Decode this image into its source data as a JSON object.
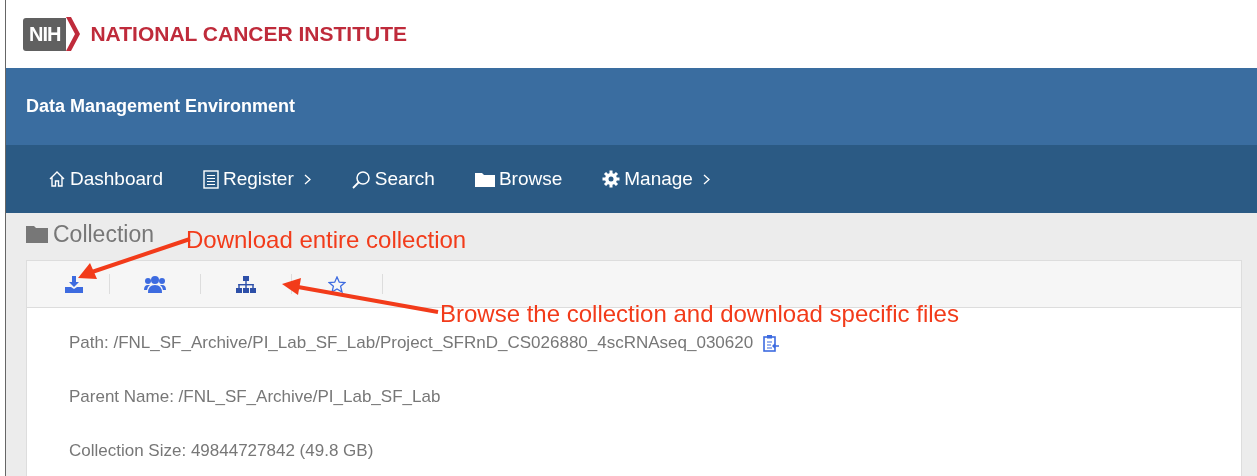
{
  "logo": {
    "badge": "NIH",
    "name": "NATIONAL CANCER INSTITUTE"
  },
  "app_title": "Data Management Environment",
  "nav": [
    {
      "label": "Dashboard",
      "kind": "home",
      "has_submenu": false
    },
    {
      "label": "Register",
      "kind": "document",
      "has_submenu": true
    },
    {
      "label": "Search",
      "kind": "search",
      "has_submenu": false
    },
    {
      "label": "Browse",
      "kind": "folder",
      "has_submenu": false
    },
    {
      "label": "Manage",
      "kind": "gear",
      "has_submenu": true
    }
  ],
  "page_title": "Collection",
  "details": [
    {
      "text": "Path: /FNL_SF_Archive/PI_Lab_SF_Lab/Project_SFRnD_CS026880_4scRNAseq_030620",
      "kind": "copyable"
    },
    {
      "text": "Parent Name: /FNL_SF_Archive/PI_Lab_SF_Lab",
      "kind": "plain"
    },
    {
      "text": "Collection Size: 49844727842 (49.8 GB)",
      "kind": "plain"
    }
  ],
  "annotations": [
    {
      "text": "Download entire collection"
    },
    {
      "text": "Browse the collection and download specific files"
    }
  ]
}
